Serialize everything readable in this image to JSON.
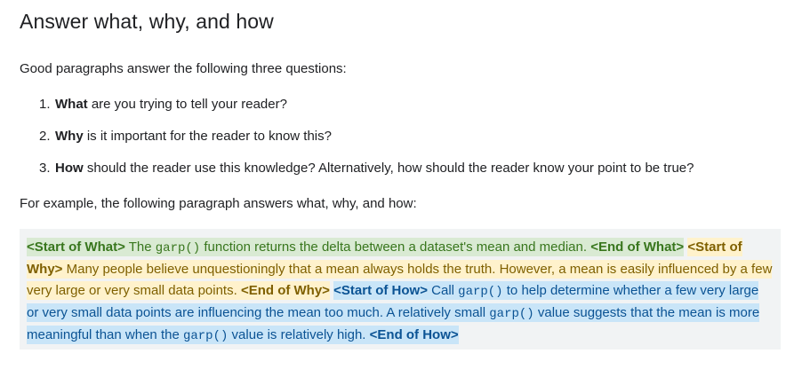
{
  "heading": "Answer what, why, and how",
  "intro": "Good paragraphs answer the following three questions:",
  "questions": [
    {
      "number": "1.",
      "bold": "What",
      "rest": " are you trying to tell your reader?"
    },
    {
      "number": "2.",
      "bold": "Why",
      "rest": " is it important for the reader to know this?"
    },
    {
      "number": "3.",
      "bold": "How",
      "rest": " should the reader use this knowledge? Alternatively, how should the reader know your point to be true?"
    }
  ],
  "example_intro": "For example, the following paragraph answers what, why, and how:",
  "example": {
    "what": {
      "start_tag": "<Start of What>",
      "text_before": " The ",
      "code": "garp()",
      "text_after": " function returns the delta between a dataset's mean and median. ",
      "end_tag": "<End of What>"
    },
    "why": {
      "start_tag": "<Start of Why>",
      "text": " Many people believe unquestioningly that a mean always holds the truth. However, a mean is easily influenced by a few very large or very small data points. ",
      "end_tag": "<End of Why>"
    },
    "how": {
      "start_tag": "<Start of How>",
      "text_1": " Call ",
      "code_1": "garp()",
      "text_2": " to help determine whether a few very large or very small data points are influencing the mean too much. A relatively small ",
      "code_2": "garp()",
      "text_3": " value suggests that the mean is more meaningful than when the ",
      "code_3": "garp()",
      "text_4": " value is relatively high. ",
      "end_tag": "<End of How>"
    }
  },
  "colors": {
    "what_bg": "#d9ead3",
    "what_fg": "#38761d",
    "why_bg": "#fff2cc",
    "why_fg": "#7f6000",
    "how_bg": "#c9e5f8",
    "how_fg": "#0b5394",
    "box_bg": "#f1f3f4"
  }
}
